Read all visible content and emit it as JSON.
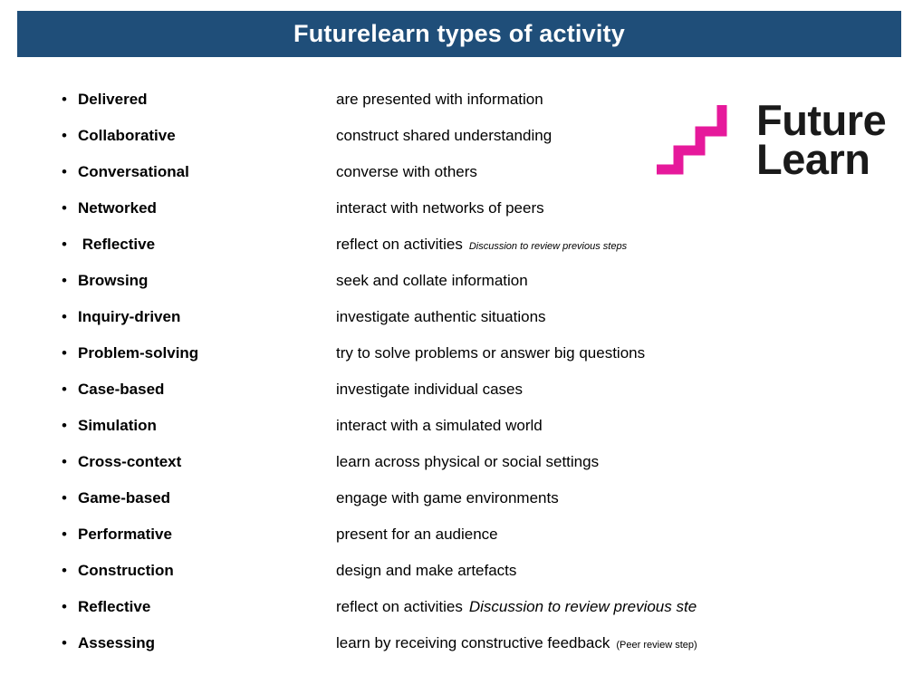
{
  "slide": {
    "title": "Futurelearn types of activity",
    "banner_color": "#1F4E79",
    "title_color": "#FFFFFF",
    "background_color": "#FFFFFF"
  },
  "logo": {
    "name": "futurelearn-logo",
    "line1": "Future",
    "line2": "Learn",
    "mark_color": "#E6199B",
    "text_color": "#1A1A1A"
  },
  "list": {
    "bullet_glyph": "•",
    "rows": [
      {
        "term": "Delivered",
        "desc": "are presented with information",
        "note": "",
        "note_style": ""
      },
      {
        "term": "Collaborative",
        "desc": "construct shared understanding",
        "note": "",
        "note_style": ""
      },
      {
        "term": "Conversational",
        "desc": "converse with others",
        "note": "",
        "note_style": ""
      },
      {
        "term": "Networked",
        "desc": "interact with networks of peers",
        "note": "",
        "note_style": ""
      },
      {
        "term": " Reflective",
        "desc": "reflect on activities",
        "note": "Discussion to review previous steps",
        "note_style": "note-small-italic"
      },
      {
        "term": "Browsing",
        "desc": "seek and collate information",
        "note": "",
        "note_style": ""
      },
      {
        "term": "Inquiry-driven",
        "desc": "investigate authentic situations",
        "note": "",
        "note_style": ""
      },
      {
        "term": "Problem-solving",
        "desc": "try to solve problems or answer big questions",
        "note": "",
        "note_style": ""
      },
      {
        "term": "Case-based",
        "desc": "investigate individual cases",
        "note": "",
        "note_style": ""
      },
      {
        "term": "Simulation",
        "desc": "interact with a simulated world",
        "note": "",
        "note_style": ""
      },
      {
        "term": "Cross-context",
        "desc": "learn across physical or social settings",
        "note": "",
        "note_style": ""
      },
      {
        "term": "Game-based",
        "desc": "engage with game environments",
        "note": "",
        "note_style": ""
      },
      {
        "term": "Performative",
        "desc": "present for an audience",
        "note": "",
        "note_style": ""
      },
      {
        "term": "Construction",
        "desc": "design and make artefacts",
        "note": "",
        "note_style": ""
      },
      {
        "term": "Reflective",
        "desc": "reflect on activities",
        "note": "Discussion to review previous ste",
        "note_style": "note-large-italic"
      },
      {
        "term": "Assessing",
        "desc": "learn by receiving constructive feedback",
        "note": "(Peer review step)",
        "note_style": "note-small-plain"
      }
    ]
  }
}
